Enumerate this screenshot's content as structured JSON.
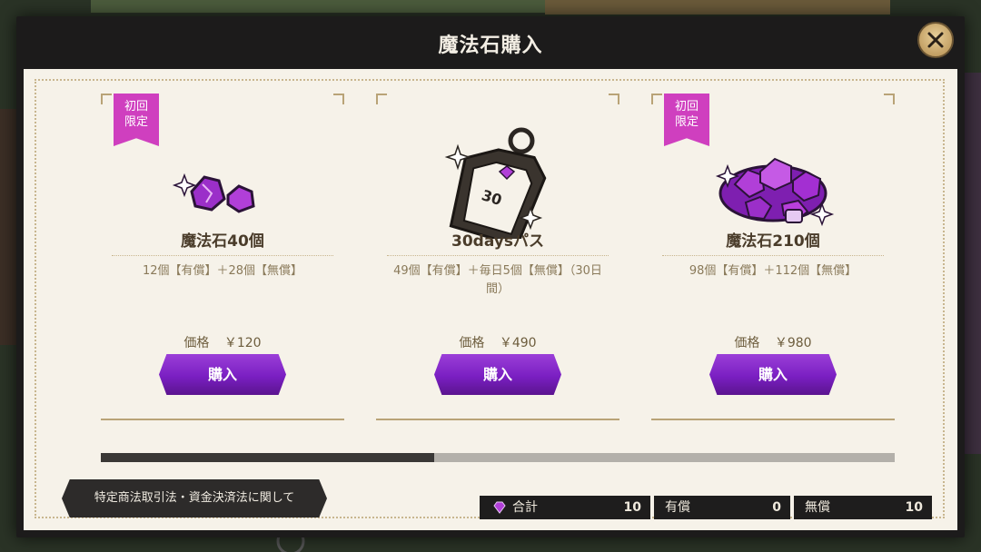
{
  "dialog": {
    "title": "魔法石購入"
  },
  "products": [
    {
      "badge": "初回\n限定",
      "name": "魔法石40個",
      "description": "12個【有償】＋28個【無償】",
      "price_label": "価格",
      "price": "￥120",
      "buy_label": "購入",
      "icon": "small-gem-icon"
    },
    {
      "badge": "",
      "name": "30daysパス",
      "description": "49個【有償】＋毎日5個【無償】（30日間）",
      "price_label": "価格",
      "price": "￥490",
      "buy_label": "購入",
      "icon": "pass-tag-icon",
      "tag_text": "30"
    },
    {
      "badge": "初回\n限定",
      "name": "魔法石210個",
      "description": "98個【有償】＋112個【無償】",
      "price_label": "価格",
      "price": "￥980",
      "buy_label": "購入",
      "icon": "gem-pile-icon"
    }
  ],
  "scroll": {
    "position_fraction": 0.42
  },
  "legal_button": {
    "label": "特定商法取引法・資金決済法に関して"
  },
  "totals": {
    "total_label": "合計",
    "total_value": "10",
    "paid_label": "有償",
    "paid_value": "0",
    "free_label": "無償",
    "free_value": "10"
  },
  "colors": {
    "accent_purple": "#7a1fc2",
    "badge_pink": "#cf3fbf",
    "gold": "#b9a377"
  }
}
